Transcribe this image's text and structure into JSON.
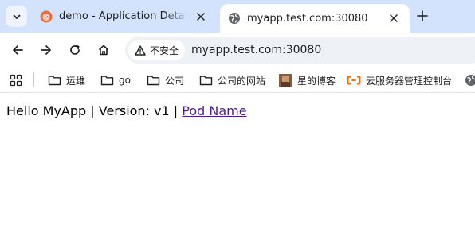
{
  "browser": {
    "tabs": [
      {
        "title": "demo - Application Details Tr",
        "icon": "argo-favicon",
        "active": false
      },
      {
        "title": "myapp.test.com:30080",
        "icon": "globe-icon",
        "active": true
      }
    ],
    "omnibox": {
      "security_label": "不安全",
      "url": "myapp.test.com:30080"
    },
    "bookmarks": [
      {
        "label": "运维",
        "icon": "folder-icon"
      },
      {
        "label": "go",
        "icon": "folder-icon"
      },
      {
        "label": "公司",
        "icon": "folder-icon"
      },
      {
        "label": "公司的网站",
        "icon": "folder-icon"
      },
      {
        "label": "星的博客",
        "icon": "avatar-favicon"
      },
      {
        "label": "云服务器管理控制台",
        "icon": "aliyun-icon"
      }
    ]
  },
  "page": {
    "text_prefix": "Hello MyApp | Version: v1 | ",
    "link_text": "Pod Name"
  },
  "colors": {
    "tabstrip_bg": "#d3e3fd",
    "omnibox_bg": "#eef1f6",
    "visited_link": "#551a8b",
    "aliyun_orange": "#ff6a00"
  }
}
